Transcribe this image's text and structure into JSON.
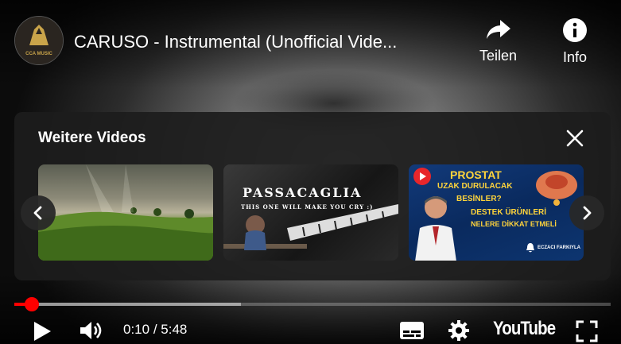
{
  "video": {
    "title": "CARUSO - Instrumental (Unofficial Vide...",
    "channel_logo_text": "CCA MUSIC"
  },
  "top_actions": {
    "share_label": "Teilen",
    "info_label": "Info"
  },
  "more_videos": {
    "heading": "Weitere Videos",
    "thumbnails": [
      {
        "icon": "landscape-thumbnail"
      },
      {
        "headline": "PASSACAGLIA",
        "subline": "THIS ONE WILL MAKE YOU CRY :)"
      },
      {
        "lines": [
          "PROSTAT",
          "UZAK DURULACAK",
          "BESİNLER?",
          "DESTEK ÜRÜNLERİ",
          "NELERE DİKKAT ETMELİ",
          "ECZACI FARKIYLA"
        ]
      }
    ]
  },
  "player": {
    "current_time": "0:10",
    "separator": " / ",
    "duration": "5:48",
    "progress_fraction": 0.029,
    "buffered_fraction": 0.38,
    "accent_color": "#ff0000",
    "brand_label": "YouTube"
  }
}
